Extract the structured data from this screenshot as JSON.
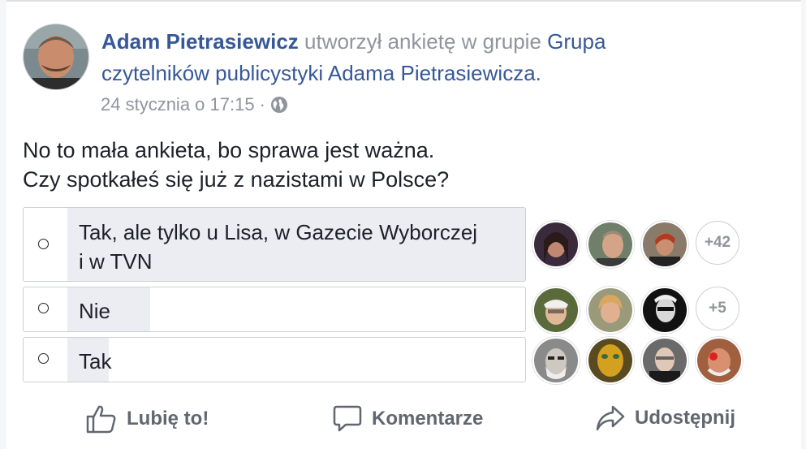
{
  "post": {
    "author": "Adam Pietrasiewicz",
    "action_text": " utworzył ankietę w grupie ",
    "group_name_line1": "Grupa",
    "group_name_line2": "czytelników publicystyki Adama Pietrasiewicza",
    "group_suffix": ".",
    "timestamp": "24 stycznia o 17:15",
    "separator": " · ",
    "privacy_icon": "globe-icon",
    "text_line1": "No to mała ankieta, bo sprawa jest ważna.",
    "text_line2": "Czy spotkałeś się już z nazistami w Polsce?"
  },
  "poll": {
    "options": [
      {
        "line1": "Tak, ale tylko u Lisa, w Gazecie Wyborczej",
        "line2": "i w TVN",
        "share": 1.0,
        "more_voters": "+42"
      },
      {
        "label": "Nie",
        "share": 0.18,
        "more_voters": "+5"
      },
      {
        "label": "Tak",
        "share": 0.09
      }
    ]
  },
  "actions": {
    "like": "Lubię to!",
    "comment": "Komentarze",
    "share": "Udostępnij"
  },
  "colors": {
    "link": "#365899",
    "secondary_text": "#90949c",
    "poll_fill": "#ebedf2"
  }
}
